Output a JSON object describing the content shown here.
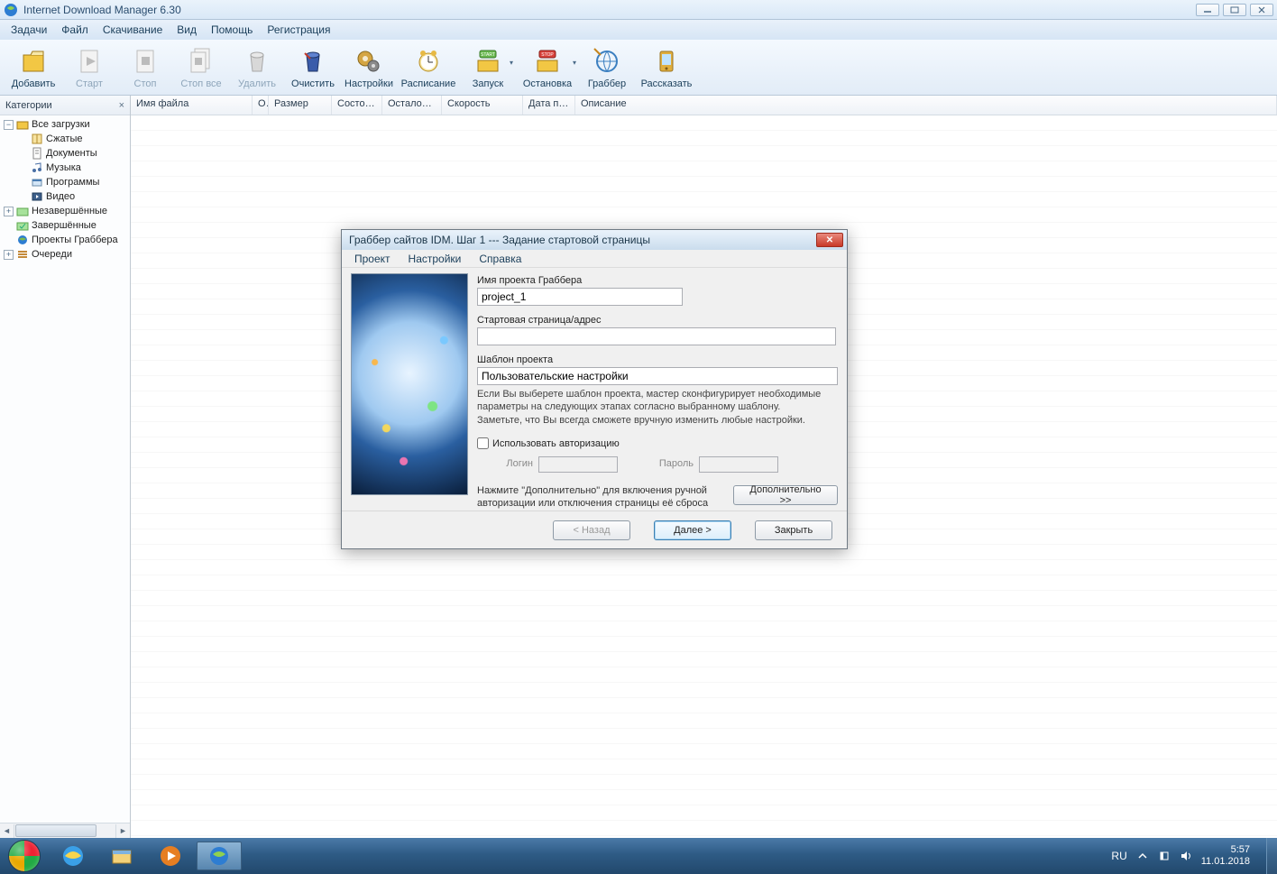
{
  "titlebar": {
    "title": "Internet Download Manager 6.30"
  },
  "menu": {
    "items": [
      "Задачи",
      "Файл",
      "Скачивание",
      "Вид",
      "Помощь",
      "Регистрация"
    ]
  },
  "toolbar": {
    "add": "Добавить",
    "start": "Старт",
    "stop": "Стоп",
    "stopall": "Стоп все",
    "delete": "Удалить",
    "cleanup": "Очистить",
    "settings": "Настройки",
    "schedule": "Расписание",
    "startqueue": "Запуск",
    "stopqueue": "Остановка",
    "grabber": "Граббер",
    "tell": "Рассказать"
  },
  "sidebar": {
    "title": "Категории",
    "nodes": {
      "all": "Все загрузки",
      "compressed": "Сжатые",
      "documents": "Документы",
      "music": "Музыка",
      "programs": "Программы",
      "video": "Видео",
      "unfinished": "Незавершённые",
      "finished": "Завершённые",
      "grabber": "Проекты Граббера",
      "queues": "Очереди"
    }
  },
  "columns": {
    "filename": "Имя файла",
    "q": "О",
    "size": "Размер",
    "state": "Состоя…",
    "remaining": "Осталось …",
    "speed": "Скорость",
    "date": "Дата по…",
    "desc": "Описание"
  },
  "dialog": {
    "title": "Граббер сайтов IDM. Шаг 1 --- Задание стартовой страницы",
    "menu": {
      "project": "Проект",
      "settings": "Настройки",
      "help": "Справка"
    },
    "project_label": "Имя проекта Граббера",
    "project_value": "project_1",
    "start_label": "Стартовая страница/адрес",
    "start_value": "",
    "template_label": "Шаблон проекта",
    "template_value": "Пользовательские настройки",
    "help1": "Если Вы выберете шаблон проекта, мастер сконфигурирует необходимые параметры на следующих этапах согласно выбранному шаблону.",
    "help2": "Заметьте, что Вы всегда сможете вручную изменить любые настройки.",
    "use_auth": "Использовать авторизацию",
    "login_label": "Логин",
    "password_label": "Пароль",
    "adv_text": "Нажмите \"Дополнительно\" для включения ручной авторизации или отключения страницы её сброса",
    "adv_btn": "Дополнительно >>",
    "back": "< Назад",
    "next": "Далее >",
    "close": "Закрыть"
  },
  "taskbar": {
    "lang": "RU",
    "time": "5:57",
    "date": "11.01.2018"
  }
}
